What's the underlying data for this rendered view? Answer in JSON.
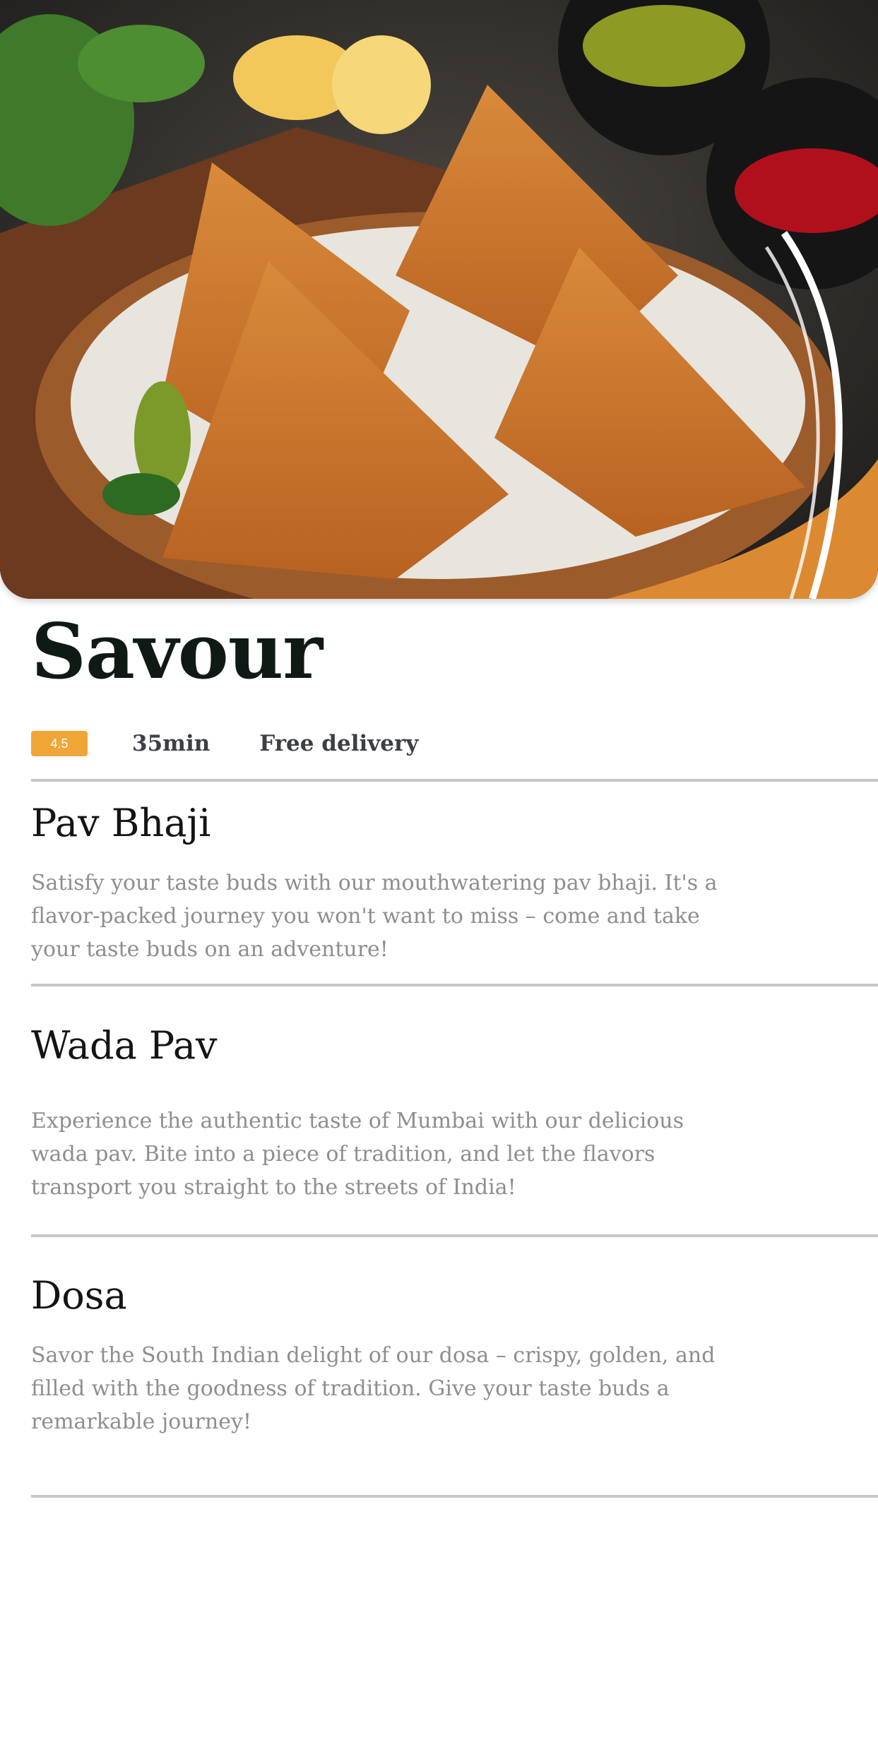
{
  "hero": {
    "image": "samosa-basket-photo"
  },
  "restaurant": {
    "name": "Savour",
    "rating": "4.5",
    "time": "35min",
    "delivery": "Free delivery"
  },
  "menu": [
    {
      "name": "Pav Bhaji",
      "description": "Satisfy your taste buds with our mouthwatering pav bhaji. It's a flavor-packed journey you won't want to miss – come and take your taste buds on an adventure!"
    },
    {
      "name": "Wada Pav",
      "description": "Experience the authentic taste of Mumbai with our delicious wada pav. Bite into a piece of tradition, and let the flavors transport you straight to the streets of India!"
    },
    {
      "name": "Dosa",
      "description": "Savor the South Indian delight of our dosa – crispy, golden, and filled with the goodness of tradition. Give your taste buds a remarkable journey!"
    }
  ],
  "colors": {
    "accent": "#f0a636",
    "title": "#0f1a14",
    "muted": "#8e8e8e"
  }
}
